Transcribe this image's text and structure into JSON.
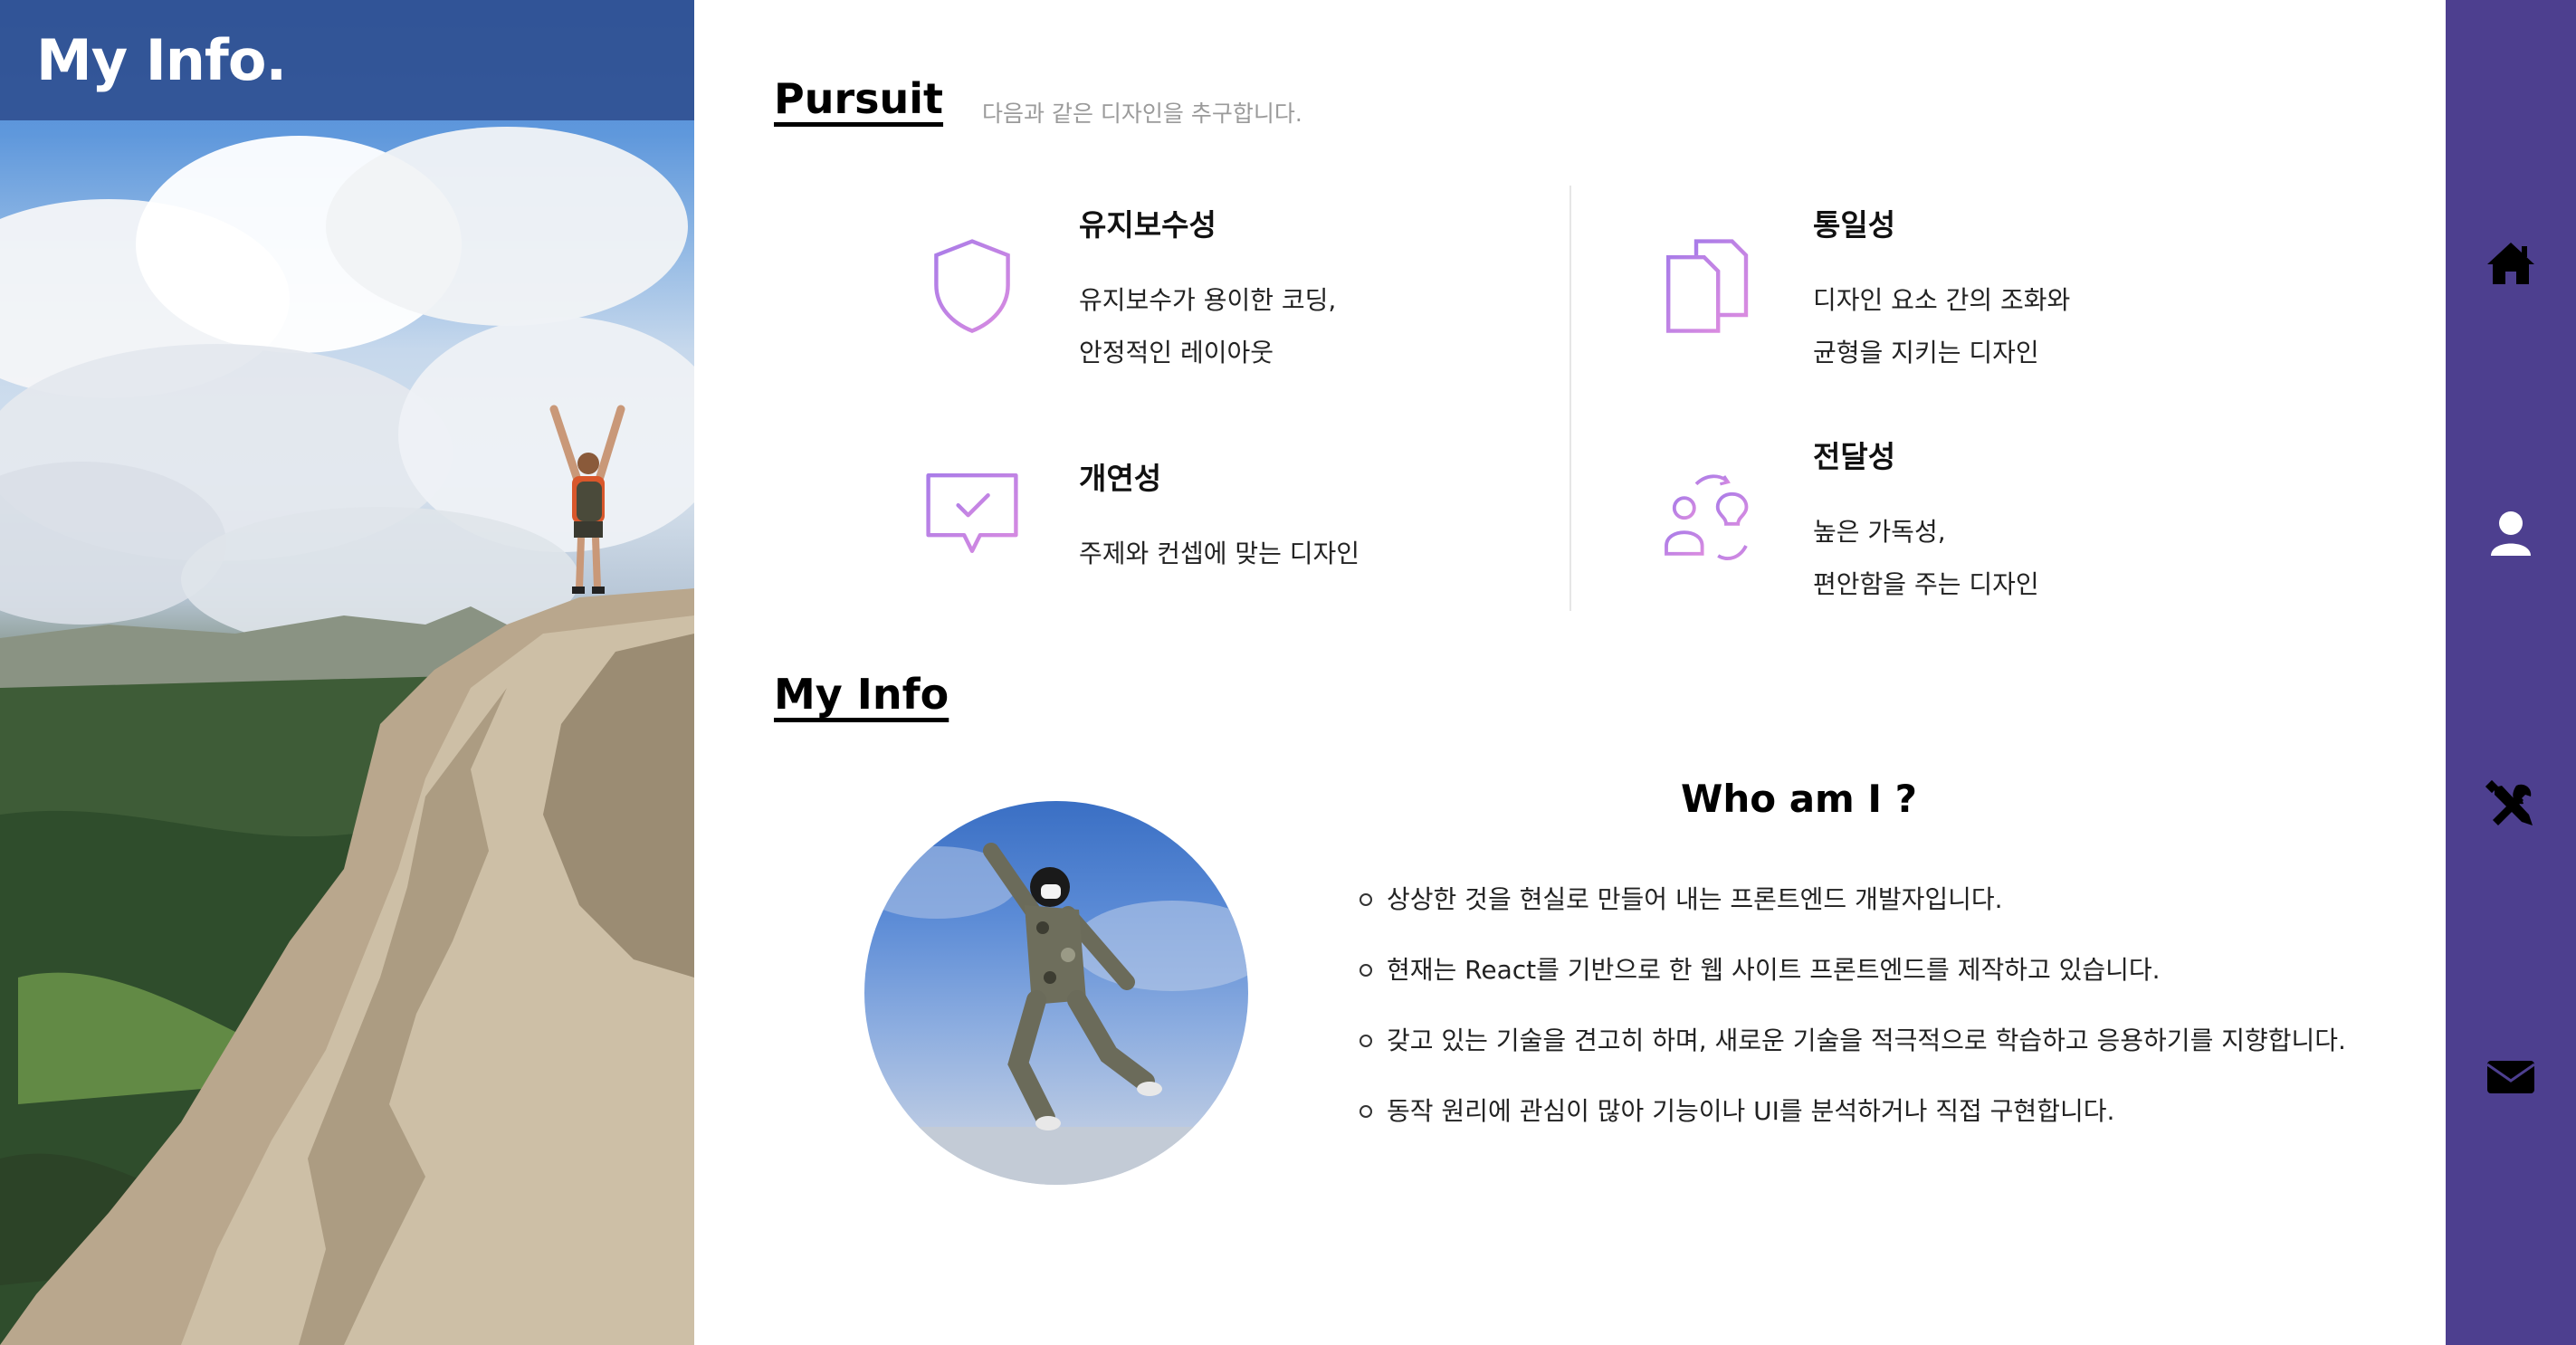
{
  "hero": {
    "title": "My Info."
  },
  "pursuit": {
    "title": "Pursuit",
    "subtitle": "다음과 같은 디자인을 추구합니다.",
    "cards": [
      {
        "icon": "shield-icon",
        "title": "유지보수성",
        "lines": [
          "유지보수가 용이한 코딩,",
          "안정적인 레이아웃"
        ]
      },
      {
        "icon": "documents-icon",
        "title": "통일성",
        "lines": [
          "디자인 요소 간의 조화와",
          "균형을 지키는 디자인"
        ]
      },
      {
        "icon": "chat-check-icon",
        "title": "개연성",
        "lines": [
          "주제와 컨셉에 맞는 디자인"
        ]
      },
      {
        "icon": "person-idea-icon",
        "title": "전달성",
        "lines": [
          "높은 가독성,",
          "편안함을 주는 디자인"
        ]
      }
    ]
  },
  "myinfo": {
    "title": "My Info",
    "who_title": "Who am I ?",
    "bullets": [
      "상상한 것을 현실로 만들어 내는 프론트엔드 개발자입니다.",
      "현재는 React를 기반으로 한 웹 사이트 프론트엔드를 제작하고 있습니다.",
      "갖고 있는 기술을 견고히 하며, 새로운 기술을 적극적으로 학습하고 응용하기를 지향합니다.",
      "동작 원리에 관심이 많아 기능이나 UI를 분석하거나 직접 구현합니다."
    ]
  },
  "nav": {
    "items": [
      {
        "icon": "home-icon"
      },
      {
        "icon": "user-icon"
      },
      {
        "icon": "tools-icon"
      },
      {
        "icon": "mail-icon"
      }
    ]
  },
  "colors": {
    "nav_bg": "#4d3f8f",
    "icon_gradient_start": "#a97ce8",
    "icon_gradient_end": "#d98be0",
    "hero_bar": "#2d4b8c"
  }
}
